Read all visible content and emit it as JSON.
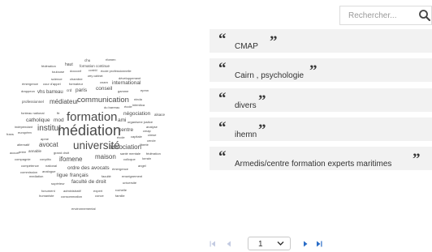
{
  "word_cloud": {
    "words": [
      {
        "text": "chu"
      },
      {
        "text": "rfomen"
      },
      {
        "text": "fédération"
      },
      {
        "text": "haut"
      },
      {
        "text": "formation continue"
      },
      {
        "text": "toulouse"
      },
      {
        "text": "docconf"
      },
      {
        "text": "contrôl"
      },
      {
        "text": "école professionnelle"
      },
      {
        "text": "science"
      },
      {
        "text": "chambre"
      },
      {
        "text": "wey cabinet"
      },
      {
        "text": "développement"
      },
      {
        "text": "émergence"
      },
      {
        "text": "cour d'appel"
      },
      {
        "text": "formateur"
      },
      {
        "text": "cnam"
      },
      {
        "text": "international"
      },
      {
        "text": "drappeon"
      },
      {
        "text": "vhs barreau"
      },
      {
        "text": "crd"
      },
      {
        "text": "paris"
      },
      {
        "text": "conseil"
      },
      {
        "text": "gamme"
      },
      {
        "text": "epmn"
      },
      {
        "text": "professionnel"
      },
      {
        "text": "médiateur"
      },
      {
        "text": "communication"
      },
      {
        "text": "ninda"
      },
      {
        "text": "du barreau"
      },
      {
        "text": "école"
      },
      {
        "text": "interdica"
      },
      {
        "text": "fonteau national"
      },
      {
        "text": "ftr"
      },
      {
        "text": "négociation"
      },
      {
        "text": "alsace"
      },
      {
        "text": "catholique"
      },
      {
        "text": "mod"
      },
      {
        "text": "formation"
      },
      {
        "text": "ami"
      },
      {
        "text": "organisme justice"
      },
      {
        "text": "indépendant"
      },
      {
        "text": "institut"
      },
      {
        "text": "analyse"
      },
      {
        "text": "frans"
      },
      {
        "text": "européen"
      },
      {
        "text": "médiation"
      },
      {
        "text": "centre"
      },
      {
        "text": "cmap"
      },
      {
        "text": "apme"
      },
      {
        "text": "école"
      },
      {
        "text": "capitale"
      },
      {
        "text": "cimse"
      },
      {
        "text": "cercle"
      },
      {
        "text": "alternatif"
      },
      {
        "text": "avocat"
      },
      {
        "text": "université"
      },
      {
        "text": "association"
      },
      {
        "text": "liberté"
      },
      {
        "text": "accuei"
      },
      {
        "text": "entre"
      },
      {
        "text": "annable"
      },
      {
        "text": "grand droit"
      },
      {
        "text": "santé mentale"
      },
      {
        "text": "fédération"
      },
      {
        "text": "compagnie"
      },
      {
        "text": "conplito"
      },
      {
        "text": "ifomene"
      },
      {
        "text": "maison"
      },
      {
        "text": "collcque"
      },
      {
        "text": "lorrain"
      },
      {
        "text": "compétence"
      },
      {
        "text": "national"
      },
      {
        "text": "angel"
      },
      {
        "text": "ordre des avocats"
      },
      {
        "text": "émergence"
      },
      {
        "text": "commission"
      },
      {
        "text": "analogue"
      },
      {
        "text": "mediation"
      },
      {
        "text": "ligue"
      },
      {
        "text": "français"
      },
      {
        "text": "faculté"
      },
      {
        "text": "enseignement"
      },
      {
        "text": "supérieur"
      },
      {
        "text": "faculté de droit"
      },
      {
        "text": "université"
      },
      {
        "text": "fonument"
      },
      {
        "text": "administratif"
      },
      {
        "text": "expert"
      },
      {
        "text": "rochelle"
      },
      {
        "text": "humaniste"
      },
      {
        "text": "consommation"
      },
      {
        "text": "conce"
      },
      {
        "text": "famille"
      },
      {
        "text": "environnemental"
      }
    ]
  },
  "search": {
    "placeholder": "Rechercher...",
    "value": "",
    "icon": "search-icon"
  },
  "list": {
    "open_quote": "“",
    "close_quote": "”",
    "items": [
      {
        "text": "CMAP"
      },
      {
        "text": "Cairn , psychologie"
      },
      {
        "text": "divers"
      },
      {
        "text": "ihemn"
      },
      {
        "text": "Armedis/centre formation experts maritimes"
      }
    ]
  },
  "pagination": {
    "current_page": "1",
    "icons": [
      "first-page-icon",
      "previous-page-icon",
      "next-page-icon",
      "last-page-icon"
    ]
  },
  "colors": {
    "row_bg": "#f2f2f2",
    "pager_inactive": "#c3cbe2",
    "pager_active": "#2a6dc7"
  }
}
